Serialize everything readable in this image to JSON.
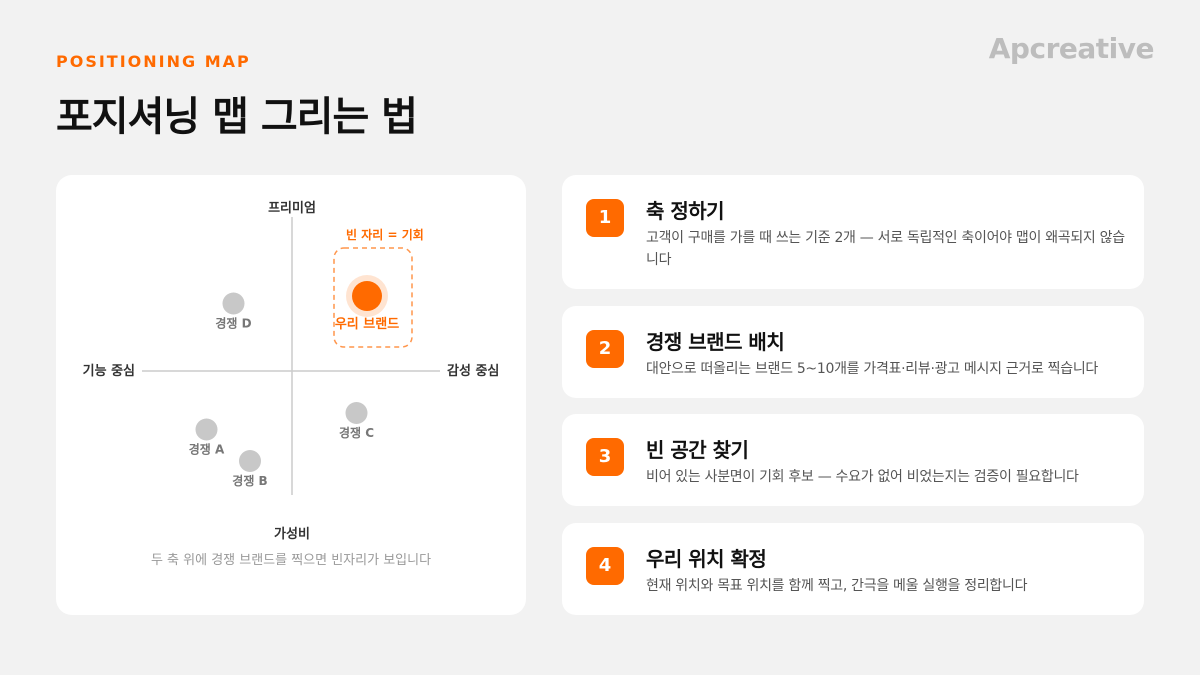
{
  "header": {
    "eyebrow": "POSITIONING MAP",
    "title": "포지셔닝 맵 그리는 법",
    "brand": "Apcreative"
  },
  "colors": {
    "accent": "#ff6a00",
    "competitor": "#c8c8c8",
    "axis": "#cccccc"
  },
  "map": {
    "axis_top": "프리미엄",
    "axis_bottom": "가성비",
    "axis_left": "기능 중심",
    "axis_right": "감성 중심",
    "opportunity_label": "빈 자리 = 기회",
    "caption": "두 축 위에 경쟁 브랜드를 찍으면 빈자리가 보입니다",
    "x_range": [
      -1,
      1
    ],
    "y_range": [
      -1,
      1
    ],
    "opportunity_zone": {
      "x": [
        0.28,
        0.8
      ],
      "y": [
        0.16,
        0.82
      ]
    },
    "points": [
      {
        "label": "우리 브랜드",
        "x": 0.5,
        "y": 0.5,
        "highlight": true
      },
      {
        "label": "경쟁 D",
        "x": -0.39,
        "y": 0.45,
        "highlight": false
      },
      {
        "label": "경쟁 C",
        "x": 0.43,
        "y": -0.28,
        "highlight": false
      },
      {
        "label": "경쟁 A",
        "x": -0.57,
        "y": -0.39,
        "highlight": false
      },
      {
        "label": "경쟁 B",
        "x": -0.28,
        "y": -0.6,
        "highlight": false
      }
    ]
  },
  "steps": [
    {
      "number": "1",
      "title": "축 정하기",
      "desc": "고객이 구매를 가를 때 쓰는 기준 2개 — 서로 독립적인 축이어야 맵이 왜곡되지 않습니다"
    },
    {
      "number": "2",
      "title": "경쟁 브랜드 배치",
      "desc": "대안으로 떠올리는 브랜드 5~10개를 가격표·리뷰·광고 메시지 근거로 찍습니다"
    },
    {
      "number": "3",
      "title": "빈 공간 찾기",
      "desc": "비어 있는 사분면이 기회 후보 — 수요가 없어 비었는지는 검증이 필요합니다"
    },
    {
      "number": "4",
      "title": "우리 위치 확정",
      "desc": "현재 위치와 목표 위치를 함께 찍고, 간극을 메울 실행을 정리합니다"
    }
  ]
}
